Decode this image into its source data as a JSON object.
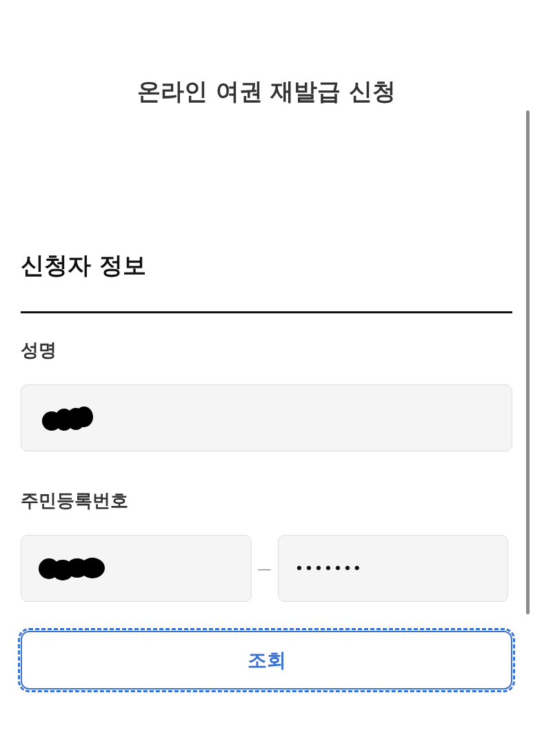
{
  "header": {
    "title": "온라인 여권 재발급 신청"
  },
  "section": {
    "title": "신청자 정보"
  },
  "fields": [
    {
      "kind": "single",
      "label": "성명",
      "parts": [
        {
          "redacted": true
        }
      ]
    },
    {
      "kind": "split",
      "label": "주민등록번호",
      "separator": "—",
      "parts": [
        {
          "redacted": true
        },
        {
          "redacted": false,
          "value": "•••••••"
        }
      ]
    }
  ],
  "button": {
    "label": "조회",
    "focused": true
  }
}
